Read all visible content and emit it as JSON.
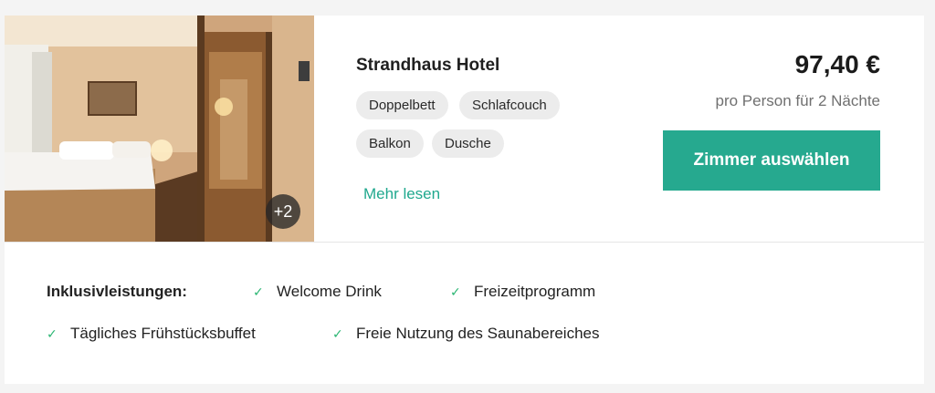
{
  "room": {
    "title": "Strandhaus Hotel",
    "photo_more_count": "+2",
    "tags": [
      "Doppelbett",
      "Schlafcouch",
      "Balkon",
      "Dusche"
    ],
    "more_link": "Mehr lesen"
  },
  "pricing": {
    "price": "97,40 €",
    "per_person_note": "pro Person für 2 Nächte",
    "select_button": "Zimmer auswählen"
  },
  "inclusions": {
    "label": "Inklusivleistungen:",
    "items": [
      "Welcome Drink",
      "Freizeitprogramm",
      "Tägliches Frühstücksbuffet",
      "Freie Nutzung des Saunabereiches"
    ]
  },
  "colors": {
    "accent": "#26a98f",
    "link": "#20a88e",
    "check": "#2bb673",
    "tag_bg": "#ececec"
  },
  "icons": {
    "check": "check-icon"
  }
}
